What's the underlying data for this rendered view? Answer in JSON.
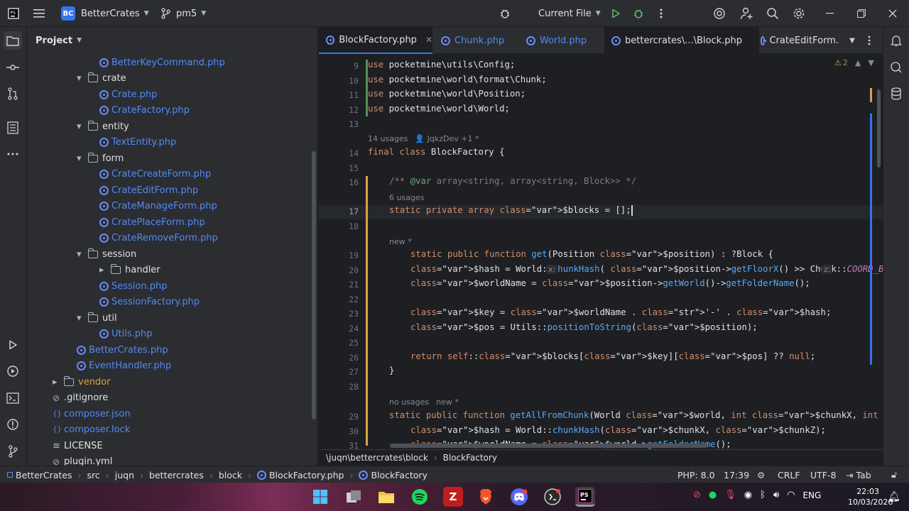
{
  "titlebar": {
    "project_badge": "BC",
    "project_name": "BetterCrates",
    "branch": "pm5",
    "run_config": "Current File"
  },
  "project_panel": {
    "title": "Project"
  },
  "tree": [
    {
      "label": "BetterKeyCommand.php",
      "type": "php",
      "indent": 2
    },
    {
      "label": "crate",
      "type": "folder",
      "indent": 1,
      "open": true
    },
    {
      "label": "Crate.php",
      "type": "php",
      "indent": 2
    },
    {
      "label": "CrateFactory.php",
      "type": "php",
      "indent": 2
    },
    {
      "label": "entity",
      "type": "folder",
      "indent": 1,
      "open": true
    },
    {
      "label": "TextEntity.php",
      "type": "php",
      "indent": 2
    },
    {
      "label": "form",
      "type": "folder",
      "indent": 1,
      "open": true
    },
    {
      "label": "CrateCreateForm.php",
      "type": "php",
      "indent": 2
    },
    {
      "label": "CrateEditForm.php",
      "type": "php",
      "indent": 2
    },
    {
      "label": "CrateManageForm.php",
      "type": "php",
      "indent": 2
    },
    {
      "label": "CratePlaceForm.php",
      "type": "php",
      "indent": 2
    },
    {
      "label": "CrateRemoveForm.php",
      "type": "php",
      "indent": 2
    },
    {
      "label": "session",
      "type": "folder",
      "indent": 1,
      "open": true
    },
    {
      "label": "handler",
      "type": "folder",
      "indent": 2,
      "open": false
    },
    {
      "label": "Session.php",
      "type": "php",
      "indent": 2
    },
    {
      "label": "SessionFactory.php",
      "type": "php",
      "indent": 2
    },
    {
      "label": "util",
      "type": "folder",
      "indent": 1,
      "open": true
    },
    {
      "label": "Utils.php",
      "type": "php",
      "indent": 2
    },
    {
      "label": "BetterCrates.php",
      "type": "php",
      "indent": 1
    },
    {
      "label": "EventHandler.php",
      "type": "php",
      "indent": 1
    },
    {
      "label": "vendor",
      "type": "vendor",
      "indent": 0,
      "open": false
    },
    {
      "label": ".gitignore",
      "type": "file",
      "indent": 0
    },
    {
      "label": "composer.json",
      "type": "json",
      "indent": 0
    },
    {
      "label": "composer.lock",
      "type": "json",
      "indent": 0
    },
    {
      "label": "LICENSE",
      "type": "text",
      "indent": 0
    },
    {
      "label": "plugin.yml",
      "type": "file",
      "indent": 0
    }
  ],
  "tabs": [
    {
      "label": "BlockFactory.php",
      "active": true
    },
    {
      "label": "Chunk.php",
      "active": false
    },
    {
      "label": "World.php",
      "active": false
    },
    {
      "label": "bettercrates\\...\\Block.php",
      "active": false
    },
    {
      "label": "CrateEditForm.",
      "active": false
    }
  ],
  "editor": {
    "warnings_count": "2",
    "hints": {
      "usages_14": "14 usages",
      "author": "JqkzDev +1 *",
      "usages_6": "6 usages",
      "new_1": "new *",
      "no_usages": "no usages",
      "new_2": "new *",
      "param_x": "x:",
      "param_z": "z:"
    },
    "lines": [
      {
        "n": "9",
        "code": "use pocketmine\\utils\\Config;"
      },
      {
        "n": "10",
        "code": "use pocketmine\\world\\format\\Chunk;"
      },
      {
        "n": "11",
        "code": "use pocketmine\\world\\Position;"
      },
      {
        "n": "12",
        "code": "use pocketmine\\world\\World;"
      },
      {
        "n": "13",
        "code": ""
      },
      {
        "n": "14",
        "code": "final class BlockFactory {"
      },
      {
        "n": "15",
        "code": ""
      },
      {
        "n": "16",
        "code": "/** @var array<string, array<string, Block>> */"
      },
      {
        "n": "17",
        "code": "static private array $blocks = [];"
      },
      {
        "n": "18",
        "code": ""
      },
      {
        "n": "19",
        "code": "static public function get(Position $position) : ?Block {"
      },
      {
        "n": "20",
        "code": "$hash = World::chunkHash( $position->getFloorX() >> Chunk::COORD_BIT_SIZE,  $position"
      },
      {
        "n": "21",
        "code": "$worldName = $position->getWorld()->getFolderName();"
      },
      {
        "n": "22",
        "code": ""
      },
      {
        "n": "23",
        "code": "$key = $worldName . '-' . $hash;"
      },
      {
        "n": "24",
        "code": "$pos = Utils::positionToString($position);"
      },
      {
        "n": "25",
        "code": ""
      },
      {
        "n": "26",
        "code": "return self::$blocks[$key][$pos] ?? null;"
      },
      {
        "n": "27",
        "code": "}"
      },
      {
        "n": "28",
        "code": ""
      },
      {
        "n": "29",
        "code": "static public function getAllFromChunk(World $world, int $chunkX, int $chunkZ) : array {"
      },
      {
        "n": "30",
        "code": "$hash = World::chunkHash($chunkX, $chunkZ);"
      },
      {
        "n": "31",
        "code": "$worldName = $world->getFolderName();"
      }
    ]
  },
  "pathbar": {
    "path": "\\juqn\\bettercrates\\block",
    "cls": "BlockFactory"
  },
  "breadcrumbs": [
    "BetterCrates",
    "src",
    "juqn",
    "bettercrates",
    "block",
    "BlockFactory.php",
    "BlockFactory"
  ],
  "status": {
    "php": "PHP: 8.0",
    "pos": "17:39",
    "eol": "CRLF",
    "enc": "UTF-8",
    "indent": "Tab"
  },
  "taskbar": {
    "lang": "ENG",
    "time": "22:03",
    "date": "10/03/2026"
  },
  "colors": {
    "accent": "#3574f0",
    "bg": "#1e1f22",
    "panel": "#2b2d30"
  }
}
